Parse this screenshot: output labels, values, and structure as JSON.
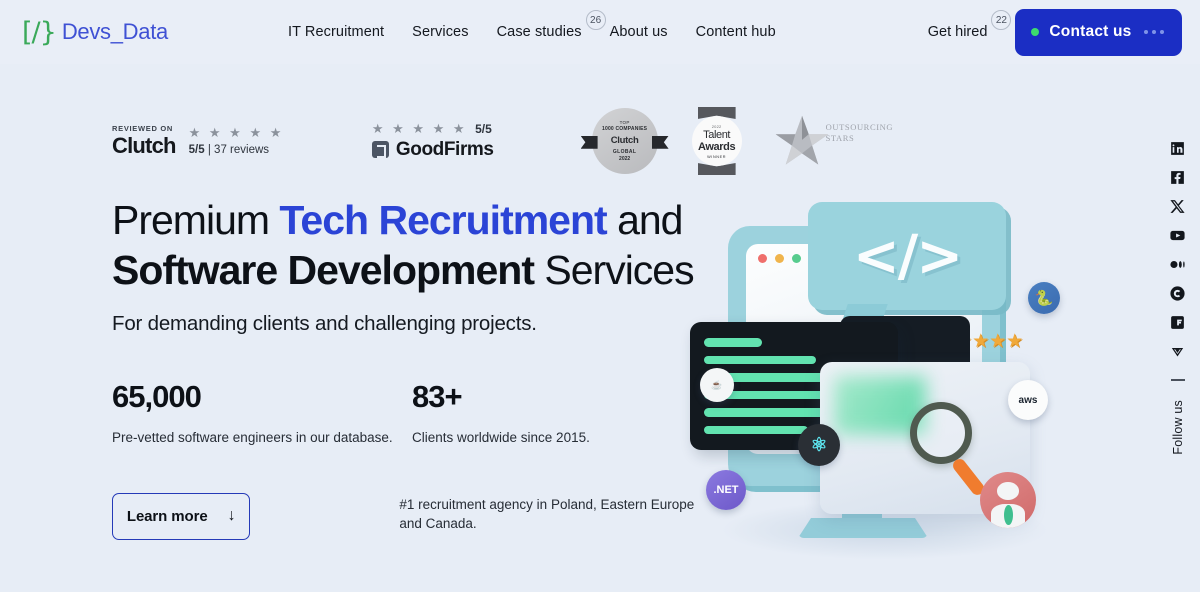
{
  "brand": {
    "mark": "[/}",
    "name": "Devs_Data"
  },
  "nav": {
    "items": [
      {
        "label": "IT Recruitment",
        "badge": null
      },
      {
        "label": "Services",
        "badge": null
      },
      {
        "label": "Case studies",
        "badge": "26"
      },
      {
        "label": "About us",
        "badge": null
      },
      {
        "label": "Content hub",
        "badge": null
      }
    ],
    "get_hired": {
      "label": "Get hired",
      "badge": "22"
    },
    "contact": {
      "label": "Contact us",
      "status_color": "#3ddc6e",
      "bg_color": "#1b2ec4"
    }
  },
  "reviews": {
    "clutch": {
      "reviewed_on": "REVIEWED ON",
      "name": "Clutch",
      "stars": "★ ★ ★ ★ ★",
      "score": "5/5",
      "separator": "|",
      "count": "37 reviews"
    },
    "goodfirms": {
      "stars": "★ ★ ★ ★ ★",
      "score": "5/5",
      "name": "GoodFirms"
    },
    "awards": [
      {
        "id": "clutch-top-1000",
        "line1": "TOP",
        "line2": "1000 COMPANIES",
        "line3": "Clutch",
        "line4": "GLOBAL",
        "line5": "2022"
      },
      {
        "id": "talent-awards",
        "year": "2022",
        "line1": "Talent",
        "line2": "Awards",
        "line3": "WINNER"
      },
      {
        "id": "outsourcing-stars",
        "line1": "OUTSOURCING",
        "line2": "STARS"
      }
    ]
  },
  "hero": {
    "title_part1": "Premium ",
    "title_highlight": "Tech Recruitment",
    "title_part2": " and",
    "title_bold": "Software Development",
    "title_part3": " Services",
    "subhead": "For demanding clients and challenging projects.",
    "highlight_color": "#2b44d6",
    "stats": [
      {
        "number": "65,000",
        "desc": "Pre-vetted software engineers in our database."
      },
      {
        "number": "83+",
        "desc": "Clients worldwide since 2015."
      }
    ],
    "cta": {
      "label": "Learn more",
      "arrow": "↓"
    },
    "rank_text": "#1 recruitment agency in Poland, Eastern Europe and Canada."
  },
  "illustration": {
    "code_symbol": "</>",
    "stars": "★★★★★",
    "tech_badges": [
      {
        "name": "java-badge",
        "label": "☕"
      },
      {
        "name": "react-badge",
        "label": "⚛"
      },
      {
        "name": "dotnet-badge",
        "label": ".NET"
      },
      {
        "name": "python-badge",
        "label": "🐍"
      },
      {
        "name": "aws-badge",
        "label": "aws"
      }
    ]
  },
  "social": {
    "icons": [
      "linkedin-icon",
      "facebook-icon",
      "x-twitter-icon",
      "youtube-icon",
      "medium-icon",
      "clutch-icon",
      "goodfirms-icon",
      "chevron-down-icon"
    ],
    "follow_label": "Follow us"
  }
}
